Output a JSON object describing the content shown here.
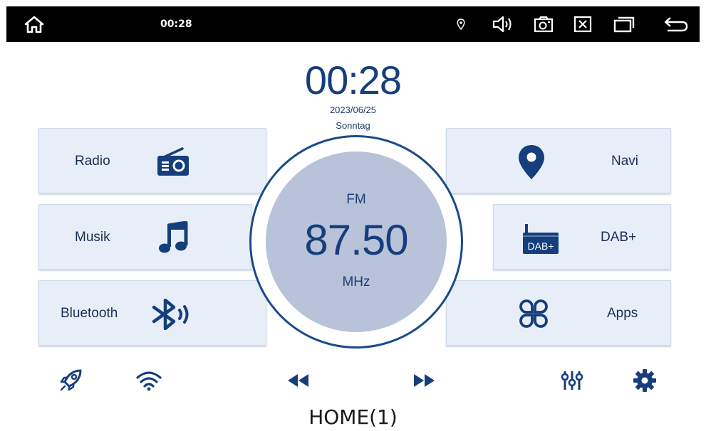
{
  "status_bar": {
    "time": "00:28",
    "icons": [
      "home-icon",
      "location-icon",
      "volume-icon",
      "screenshot-icon",
      "close-window-icon",
      "recent-apps-icon",
      "back-icon"
    ]
  },
  "clock": {
    "time": "00:28",
    "date": "2023/06/25",
    "day": "Sonntag"
  },
  "tiles": {
    "radio": "Radio",
    "musik": "Musik",
    "bluetooth": "Bluetooth",
    "navi": "Navi",
    "dab": "DAB+",
    "apps": "Apps",
    "dab_icon_text": "DAB+"
  },
  "tuner": {
    "band": "FM",
    "frequency": "87.50",
    "unit": "MHz"
  },
  "bottom_bar": {
    "icons": [
      "rocket-icon",
      "wifi-icon",
      "rewind-icon",
      "fast-forward-icon",
      "equalizer-icon",
      "settings-icon"
    ]
  },
  "caption": "HOME(1)",
  "colors": {
    "accent": "#163e7c",
    "tile_bg": "#e7eef7",
    "disc_bg": "#b8c3da",
    "status_bg": "#000000"
  }
}
